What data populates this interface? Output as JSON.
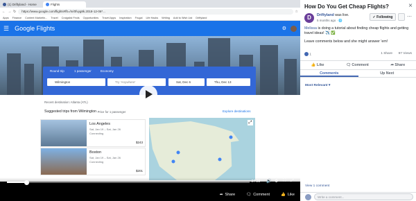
{
  "browser": {
    "tabs": [
      "(1) Driftyland - Home",
      "Flights"
    ],
    "url": "https://www.google.com/flights#flt=/m/0fvyg8k.2018-12-06*...",
    "bookmarks": [
      "Apps",
      "Finance",
      "Content Marketin...",
      "Travel",
      "Craigslist Finds",
      "Opportunities",
      "Travel Apps",
      "Inspiration",
      "Frugal",
      "Life Hacks",
      "Writing",
      "Add to Wish List",
      "Driftyland"
    ]
  },
  "flights": {
    "brand": "Google Flights",
    "trip_type": "Round trip",
    "passengers": "1 passenger",
    "cabin": "Economy",
    "origin": "Wilmington",
    "destination_placeholder": "Try 'Anywhere'",
    "depart": "Sat, Dec 6",
    "return": "Thu, Dec 13",
    "recent": "Recent destination: Atlanta (ATL)",
    "suggested": "Suggested trips from Wilmington",
    "price_note": "· Price for 1 passenger",
    "explore": "Explore destinations",
    "trips": [
      {
        "city": "Los Angeles",
        "dates": "Sat, Jan 19 – Sat, Jan 26",
        "stops": "Connecting",
        "price": "$243"
      },
      {
        "city": "Boston",
        "dates": "Sat, Jan 19 – Sat, Jan 26",
        "stops": "Connecting",
        "price": "$201"
      }
    ]
  },
  "player": {
    "progress": 0.08,
    "time_remaining": "-27:28",
    "share": "Share",
    "comment": "Comment",
    "like": "Like"
  },
  "post": {
    "title": "How Do You Get Cheap Flights?",
    "page_name": "Driftyland",
    "status": "was live.",
    "time": "5 months ago",
    "follow_label": "Following",
    "message_tag": "Melissa",
    "message_rest": "is doing a tutorial about finding cheap flights and getting travel ideas! ✈️ ✅",
    "message2": "Leave comments below and she might answer 'em!",
    "reactions": "1",
    "shares": "1 Share",
    "views": "97 Views",
    "actions": [
      "Like",
      "Comment",
      "Share"
    ],
    "tabs": [
      "Comments",
      "Up Next"
    ],
    "sort": "Most Relevant",
    "view_comments": "View 1 comment",
    "comment_placeholder": "Write a comment..."
  }
}
